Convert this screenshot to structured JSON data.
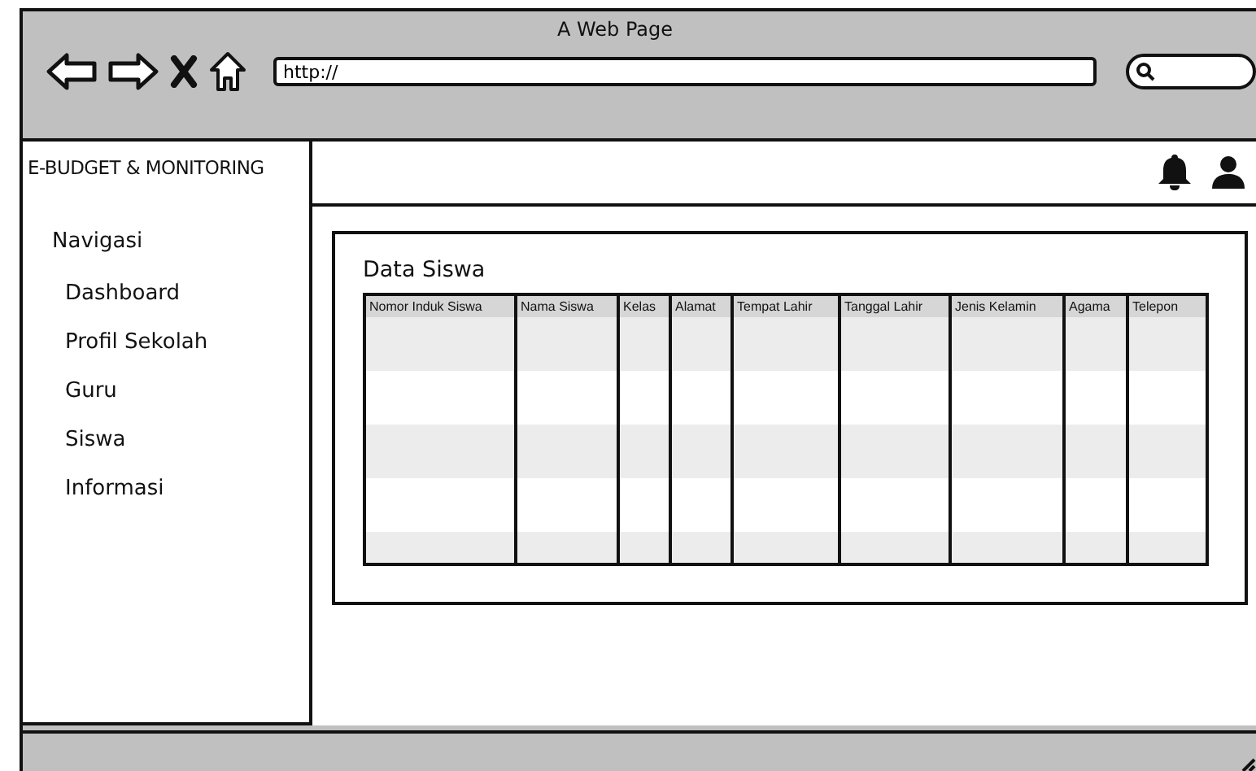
{
  "window": {
    "title": "A Web Page"
  },
  "address_bar": {
    "value": "http://"
  },
  "sidebar": {
    "brand": "E-BUDGET & MONITORING",
    "section": "Navigasi",
    "items": [
      {
        "label": "Dashboard"
      },
      {
        "label": "Profil Sekolah"
      },
      {
        "label": "Guru"
      },
      {
        "label": "Siswa"
      },
      {
        "label": "Informasi"
      }
    ]
  },
  "panel": {
    "title": "Data Siswa",
    "table": {
      "columns": [
        "Nomor Induk Siswa",
        "Nama Siswa",
        "Kelas",
        "Alamat",
        "Tempat Lahir",
        "Tanggal Lahir",
        "Jenis Kelamin",
        "Agama",
        "Telepon"
      ]
    }
  }
}
